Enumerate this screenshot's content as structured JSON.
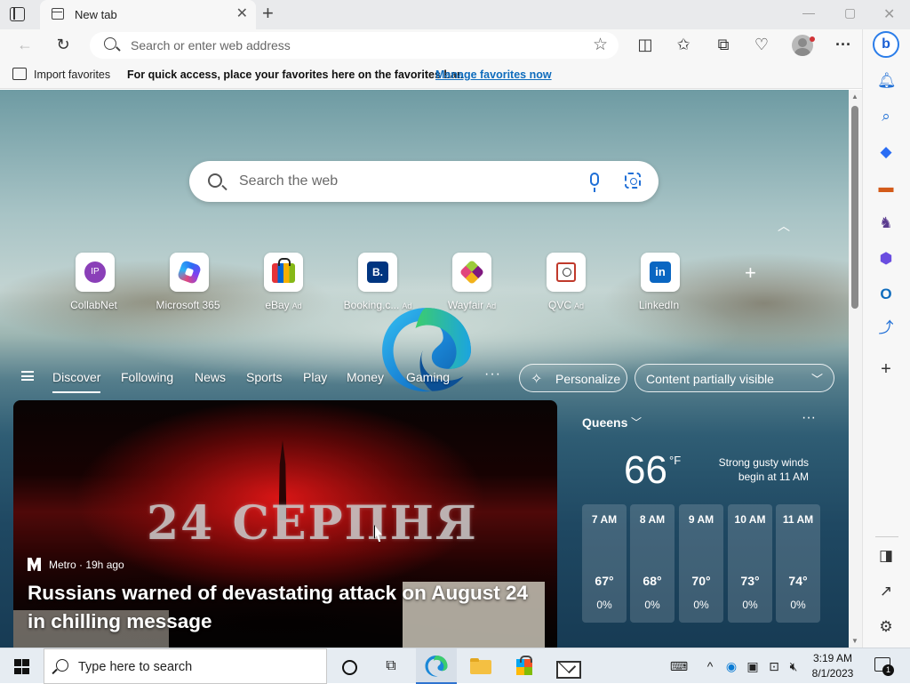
{
  "tabs": [
    {
      "title": "New tab"
    }
  ],
  "window_controls": {
    "minimize": "—",
    "maximize": "▢",
    "close": "✕"
  },
  "address_bar": {
    "placeholder": "Search or enter web address"
  },
  "favorites_bar": {
    "import_label": "Import favorites",
    "hint": "For quick access, place your favorites here on the favorites bar.",
    "manage_link": "Manage favorites now"
  },
  "ntp": {
    "search_placeholder": "Search the web",
    "quick_links": [
      {
        "label": "CollabNet",
        "ad": "",
        "icon": "collabnet-logo-icon",
        "glyph": "IP"
      },
      {
        "label": "Microsoft 365",
        "ad": "",
        "icon": "microsoft-365-logo-icon",
        "glyph": ""
      },
      {
        "label": "eBay",
        "ad": "Ad",
        "icon": "ebay-logo-icon",
        "glyph": ""
      },
      {
        "label": "Booking.c...",
        "ad": "Ad",
        "icon": "booking-logo-icon",
        "glyph": "B."
      },
      {
        "label": "Wayfair",
        "ad": "Ad",
        "icon": "wayfair-logo-icon",
        "glyph": ""
      },
      {
        "label": "QVC",
        "ad": "Ad",
        "icon": "qvc-logo-icon",
        "glyph": ""
      },
      {
        "label": "LinkedIn",
        "ad": "",
        "icon": "linkedin-logo-icon",
        "glyph": "in"
      }
    ],
    "feed_tabs": [
      "Discover",
      "Following",
      "News",
      "Sports",
      "Play",
      "Money",
      "Gaming"
    ],
    "active_feed_tab": "Discover",
    "more_label": "···",
    "personalize_label": "Personalize",
    "content_visibility": "Content partially visible"
  },
  "news": {
    "image_text": "24 СЕРПНЯ",
    "source": "Metro · 19h ago",
    "headline": "Russians warned of devastating attack on August 24 in chilling message"
  },
  "weather": {
    "location": "Queens",
    "temperature": "66",
    "unit": "°F",
    "summary": "Strong gusty winds begin at 11 AM",
    "hourly": [
      {
        "time": "7 AM",
        "temp": "67°",
        "precip": "0%"
      },
      {
        "time": "8 AM",
        "temp": "68°",
        "precip": "0%"
      },
      {
        "time": "9 AM",
        "temp": "70°",
        "precip": "0%"
      },
      {
        "time": "10 AM",
        "temp": "73°",
        "precip": "0%"
      },
      {
        "time": "11 AM",
        "temp": "74°",
        "precip": "0%"
      }
    ]
  },
  "taskbar": {
    "search_placeholder": "Type here to search",
    "time": "3:19 AM",
    "date": "8/1/2023",
    "notification_count": "1"
  },
  "colors": {
    "accent": "#0f6cbd",
    "edge_blue": "#1f6fd6",
    "taskbar": "#e6ecf2"
  }
}
